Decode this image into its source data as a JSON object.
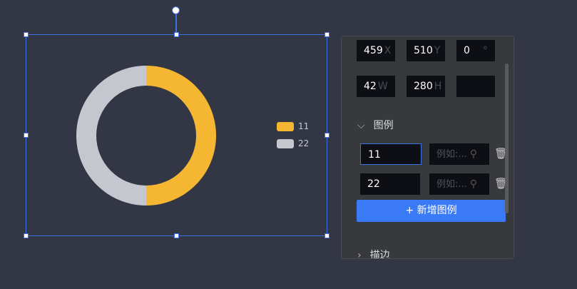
{
  "chart_data": {
    "type": "pie",
    "donut": true,
    "categories": [
      "11",
      "22"
    ],
    "values": [
      50,
      50
    ],
    "colors": [
      "#f5b731",
      "#c5c6ce"
    ],
    "legend": "right"
  },
  "panel": {
    "x": {
      "value": "459",
      "suffix": "X"
    },
    "y": {
      "value": "510",
      "suffix": "Y"
    },
    "rotation": {
      "value": "0",
      "suffix": "°"
    },
    "w": {
      "value": "42",
      "suffix": "W"
    },
    "h": {
      "value": "280",
      "suffix": "H"
    },
    "legend_section": "图例",
    "legend_items": [
      {
        "name": "11",
        "placeholder": "例如:..."
      },
      {
        "name": "22",
        "placeholder": "例如:..."
      }
    ],
    "add_button": "+ 新增图例",
    "stroke_section": "描边"
  }
}
